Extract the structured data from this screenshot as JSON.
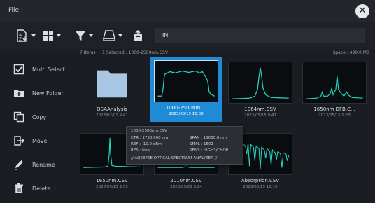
{
  "window": {
    "title": "File",
    "close_glyph": "✕"
  },
  "toolbar": {
    "sort_icon": "sort-az-icon",
    "view_icon": "grid-view-icon",
    "filter_icon": "filter-icon",
    "drive_icon": "drive-icon",
    "up_folder_icon": "up-folder-icon",
    "path": "INI"
  },
  "status": {
    "items": "7 Items",
    "selected": "1 Selected : 1000-2500nm.CSV",
    "space": "Space : 490.0 MB"
  },
  "sidebar": {
    "items": [
      {
        "label": "Multi Select",
        "icon": "checkbox-icon"
      },
      {
        "label": "New Folder",
        "icon": "new-folder-icon"
      },
      {
        "label": "Copy",
        "icon": "copy-icon"
      },
      {
        "label": "Move",
        "icon": "move-icon"
      },
      {
        "label": "Rename",
        "icon": "pencil-icon"
      },
      {
        "label": "Delete",
        "icon": "trash-icon"
      }
    ]
  },
  "files": [
    {
      "name": "OSAAnalysis",
      "date": "2023/02/01 9:41",
      "kind": "folder"
    },
    {
      "name": "1000-2500nm....",
      "date": "2023/05/15 10:08",
      "kind": "plateau",
      "selected": true
    },
    {
      "name": "1064nm.CSV",
      "date": "2023/05/15 9:47",
      "kind": "peak"
    },
    {
      "name": "1650nm DFB.C...",
      "date": "2023/05/15 9:53",
      "kind": "multipeak"
    },
    {
      "name": "1650nm.CSV",
      "date": "2023/05/15 9:55",
      "kind": "spike"
    },
    {
      "name": "2010nm.CSV",
      "date": "2023/05/03 3:24",
      "kind": "flat"
    },
    {
      "name": "Absorption.CSV",
      "date": "2023/05/15 10:10",
      "kind": "absorption"
    }
  ],
  "tooltip": {
    "filename": "1000-2500nm.CSV",
    "ctr": "CTR : 1750.000 nm",
    "span": "SPAN : 15000.0 nm",
    "ref": "REF : -10.0 dBm",
    "smpl": "SMPL : 1501",
    "res": "RES : free",
    "sens": "SENS : HIGH3/CHOP",
    "model": "// AQ6375E OPTICAL SPECTRUM ANALYZER //"
  },
  "colors": {
    "accent": "#1f8bd6",
    "trace": "#29d3c0",
    "folder": "#a9c6e2"
  }
}
